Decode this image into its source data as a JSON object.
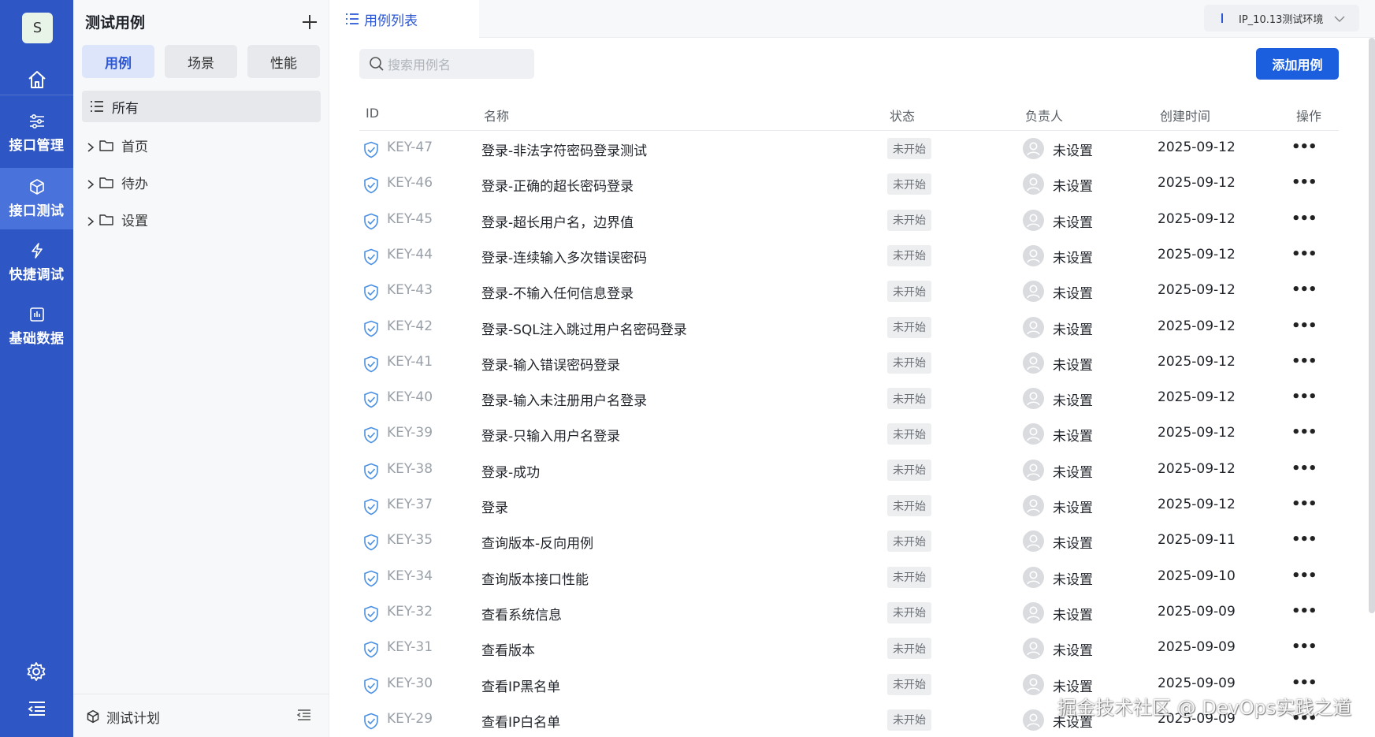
{
  "rail": {
    "avatar_letter": "S",
    "items": [
      {
        "label": "接口管理",
        "icon": "sliders-icon"
      },
      {
        "label": "接口测试",
        "icon": "cube-icon",
        "active": true
      },
      {
        "label": "快捷调试",
        "icon": "lightning-icon"
      },
      {
        "label": "基础数据",
        "icon": "chart-icon"
      }
    ]
  },
  "panel": {
    "title": "测试用例",
    "segments": [
      "用例",
      "场景",
      "性能"
    ],
    "tree_all": "所有",
    "tree": [
      "首页",
      "待办",
      "设置"
    ],
    "bottom_label": "测试计划"
  },
  "topbar": {
    "tab_label": "用例列表",
    "env_label": "IP_10.13测试环境"
  },
  "main": {
    "search_placeholder": "搜索用例名",
    "add_button": "添加用例",
    "columns": {
      "id": "ID",
      "name": "名称",
      "status": "状态",
      "owner": "负责人",
      "created": "创建时间",
      "action": "操作"
    },
    "rows": [
      {
        "id": "KEY-47",
        "name": "登录-非法字符密码登录测试",
        "status": "未开始",
        "owner": "未设置",
        "date": "2025-09-12"
      },
      {
        "id": "KEY-46",
        "name": "登录-正确的超长密码登录",
        "status": "未开始",
        "owner": "未设置",
        "date": "2025-09-12"
      },
      {
        "id": "KEY-45",
        "name": "登录-超长用户名，边界值",
        "status": "未开始",
        "owner": "未设置",
        "date": "2025-09-12"
      },
      {
        "id": "KEY-44",
        "name": "登录-连续输入多次错误密码",
        "status": "未开始",
        "owner": "未设置",
        "date": "2025-09-12"
      },
      {
        "id": "KEY-43",
        "name": "登录-不输入任何信息登录",
        "status": "未开始",
        "owner": "未设置",
        "date": "2025-09-12"
      },
      {
        "id": "KEY-42",
        "name": "登录-SQL注入跳过用户名密码登录",
        "status": "未开始",
        "owner": "未设置",
        "date": "2025-09-12"
      },
      {
        "id": "KEY-41",
        "name": "登录-输入错误密码登录",
        "status": "未开始",
        "owner": "未设置",
        "date": "2025-09-12"
      },
      {
        "id": "KEY-40",
        "name": "登录-输入未注册用户名登录",
        "status": "未开始",
        "owner": "未设置",
        "date": "2025-09-12"
      },
      {
        "id": "KEY-39",
        "name": "登录-只输入用户名登录",
        "status": "未开始",
        "owner": "未设置",
        "date": "2025-09-12"
      },
      {
        "id": "KEY-38",
        "name": "登录-成功",
        "status": "未开始",
        "owner": "未设置",
        "date": "2025-09-12"
      },
      {
        "id": "KEY-37",
        "name": "登录",
        "status": "未开始",
        "owner": "未设置",
        "date": "2025-09-12"
      },
      {
        "id": "KEY-35",
        "name": "查询版本-反向用例",
        "status": "未开始",
        "owner": "未设置",
        "date": "2025-09-11"
      },
      {
        "id": "KEY-34",
        "name": "查询版本接口性能",
        "status": "未开始",
        "owner": "未设置",
        "date": "2025-09-10"
      },
      {
        "id": "KEY-32",
        "name": "查看系统信息",
        "status": "未开始",
        "owner": "未设置",
        "date": "2025-09-09"
      },
      {
        "id": "KEY-31",
        "name": "查看版本",
        "status": "未开始",
        "owner": "未设置",
        "date": "2025-09-09"
      },
      {
        "id": "KEY-30",
        "name": "查看IP黑名单",
        "status": "未开始",
        "owner": "未设置",
        "date": "2025-09-09"
      },
      {
        "id": "KEY-29",
        "name": "查看IP白名单",
        "status": "未开始",
        "owner": "未设置",
        "date": "2025-09-09"
      }
    ],
    "more_glyph": "•••"
  },
  "watermark": "掘金技术社区 @ DevOps实践之道",
  "colors": {
    "rail": "#2e56c4",
    "rail_active": "#4a72db",
    "accent": "#1b5fde",
    "check": "#4a90e2"
  }
}
